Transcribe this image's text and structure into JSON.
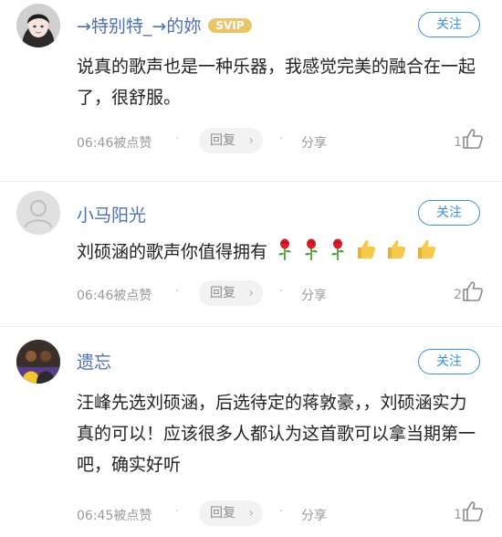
{
  "comments": [
    {
      "user": "→特别特_→的妳",
      "badge": "SVIP",
      "follow_label": "关注",
      "text": "说真的歌声也是一种乐器，我感觉完美的融合在一起了，很舒服。",
      "time": "06:46被点赞",
      "reply_label": "回复",
      "share_label": "分享",
      "likes": "1",
      "avatar_icon": "girl-avatar"
    },
    {
      "user": "小马阳光",
      "follow_label": "关注",
      "text": "刘硕涵的歌声你值得拥有",
      "emojis": [
        "rose",
        "rose",
        "rose",
        "thumbs-up",
        "thumbs-up",
        "thumbs-up"
      ],
      "time": "06:46被点赞",
      "reply_label": "回复",
      "share_label": "分享",
      "likes": "2",
      "avatar_icon": "default-user-avatar"
    },
    {
      "user": "遗忘",
      "follow_label": "关注",
      "text": "汪峰先选刘硕涵，后选待定的蒋敦豪，，刘硕涵实力真的可以！应该很多人都认为这首歌可以拿当期第一吧，确实好听",
      "time": "06:45被点赞",
      "reply_label": "回复",
      "share_label": "分享",
      "likes": "1",
      "avatar_icon": "basketball-player-avatar"
    }
  ],
  "colors": {
    "username": "#4e6fb0",
    "follow": "#3d8fd8",
    "svip": "#e9c46a",
    "meta": "#9a9a9a"
  }
}
